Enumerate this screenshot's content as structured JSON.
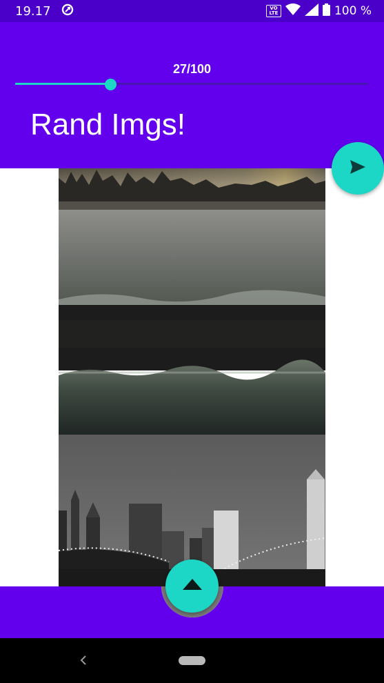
{
  "status_bar": {
    "time": "19.17",
    "volte_top": "VO",
    "volte_bottom": "LTE",
    "battery_text": "100 %"
  },
  "slider": {
    "value_text": "27/100",
    "value": 27,
    "max": 100
  },
  "app": {
    "title": "Rand Imgs!"
  },
  "icons": {
    "send": "send-icon",
    "scroll_up": "arrow-up-icon",
    "back": "back-icon",
    "home": "home-pill"
  },
  "colors": {
    "primary": "#6200ee",
    "status_bar": "#4a00c8",
    "accent": "#1dd7c6"
  }
}
